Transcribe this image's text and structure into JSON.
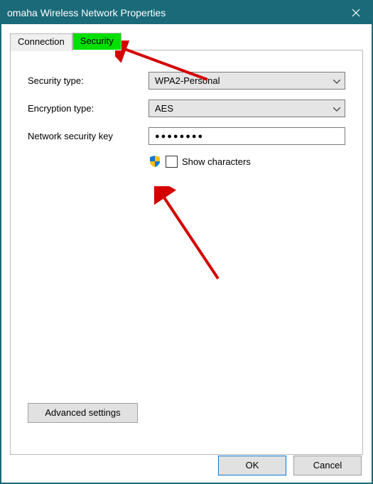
{
  "title": "omaha Wireless Network Properties",
  "tabs": {
    "connection": "Connection",
    "security": "Security"
  },
  "fields": {
    "security_type": {
      "label": "Security type:",
      "value": "WPA2-Personal"
    },
    "encryption_type": {
      "label": "Encryption type:",
      "value": "AES"
    },
    "network_key": {
      "label": "Network security key",
      "value": "●●●●●●●●"
    },
    "show_chars": {
      "label": "Show characters"
    }
  },
  "advanced": "Advanced settings",
  "buttons": {
    "ok": "OK",
    "cancel": "Cancel"
  }
}
